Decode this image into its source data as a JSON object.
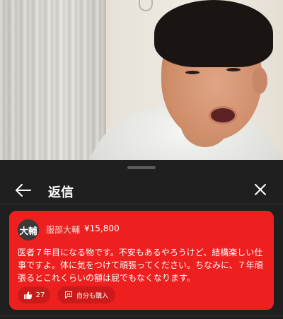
{
  "header": {
    "title": "返信"
  },
  "comment": {
    "avatar_text": "大輔",
    "author": "服部大輔",
    "amount": "¥15,800",
    "text": "医者７年目になる物です。不安もあるやろうけど、結構楽しい仕事ですよ。体に気をつけて頑張ってください。ちなみに、７年頑張るとこれくらいの額は屁でもなくなります。",
    "like_count": "27",
    "buy_label": "自分も購入"
  },
  "colors": {
    "card_background": "#ee1f1f",
    "sheet_background": "#1f1f1f"
  },
  "icons": {
    "back": "arrow-left-icon",
    "close": "close-icon",
    "like": "thumbs-up-icon",
    "buy": "super-thanks-icon"
  }
}
